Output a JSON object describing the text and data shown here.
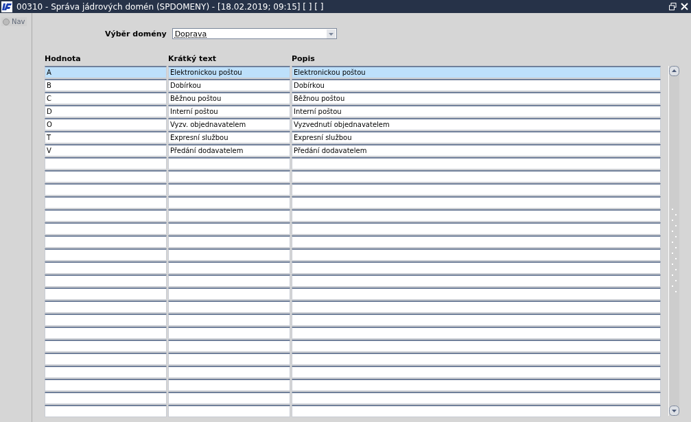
{
  "window": {
    "title": "00310 - Správa jádrových domén (SPDOMENY) - [18.02.2019; 09:15] [ ] [ ]"
  },
  "nav": {
    "label": "Nav",
    "selected": false
  },
  "domain_select": {
    "label": "Výběr domény",
    "value": "Doprava"
  },
  "table": {
    "columns": [
      "Hodnota",
      "Krátký text",
      "Popis"
    ],
    "rows": [
      {
        "cells": [
          "A",
          "Elektronickou poštou",
          "Elektronickou poštou"
        ],
        "selected": true
      },
      {
        "cells": [
          "B",
          "Dobírkou",
          "Dobírkou"
        ],
        "selected": false
      },
      {
        "cells": [
          "C",
          "Běžnou poštou",
          "Běžnou poštou"
        ],
        "selected": false
      },
      {
        "cells": [
          "D",
          "Interní poštou",
          "Interní poštou"
        ],
        "selected": false
      },
      {
        "cells": [
          "O",
          "Vyzv. objednavatelem",
          "Vyzvednutí objednavatelem"
        ],
        "selected": false
      },
      {
        "cells": [
          "T",
          "Expresní službou",
          "Expresní službou"
        ],
        "selected": false
      },
      {
        "cells": [
          "V",
          "Předání dodavatelem",
          "Předání dodavatelem"
        ],
        "selected": false
      }
    ]
  }
}
